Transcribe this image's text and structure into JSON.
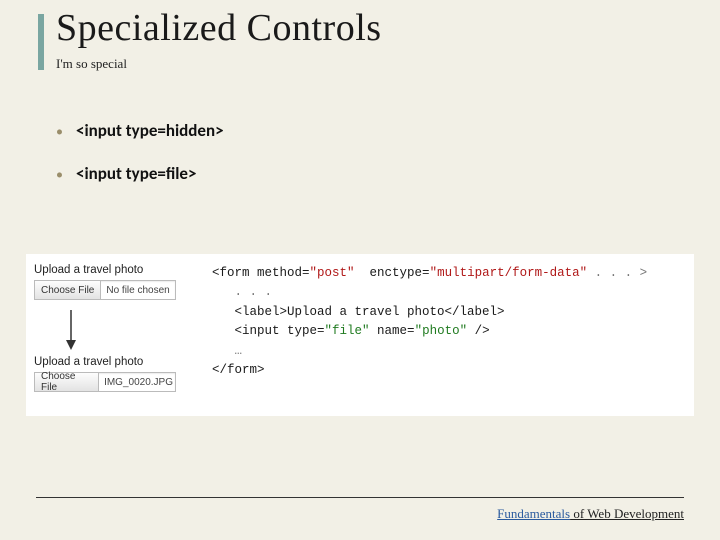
{
  "title": "Specialized Controls",
  "subtitle": "I'm so special",
  "bullets": [
    "<input type=hidden>",
    "<input type=file>"
  ],
  "ui": {
    "label": "Upload a travel photo",
    "choose_button": "Choose File",
    "state_before": "No file chosen",
    "state_after": "IMG_0020.JPG"
  },
  "code": {
    "l1_a": "<form method=",
    "l1_b": "\"post\"",
    "l1_c": "  enctype=",
    "l1_d": "\"multipart/form-data\"",
    "l1_e": " . . . >",
    "l2": "   . . .",
    "l3": "   <label>Upload a travel photo</label>",
    "l4_a": "   <input type=",
    "l4_b": "\"file\"",
    "l4_c": " name=",
    "l4_d": "\"photo\"",
    "l4_e": " />",
    "l5": "   …",
    "l6": "</form>"
  },
  "footer": {
    "blue": "Fundamentals",
    "rest": " of Web Development"
  }
}
